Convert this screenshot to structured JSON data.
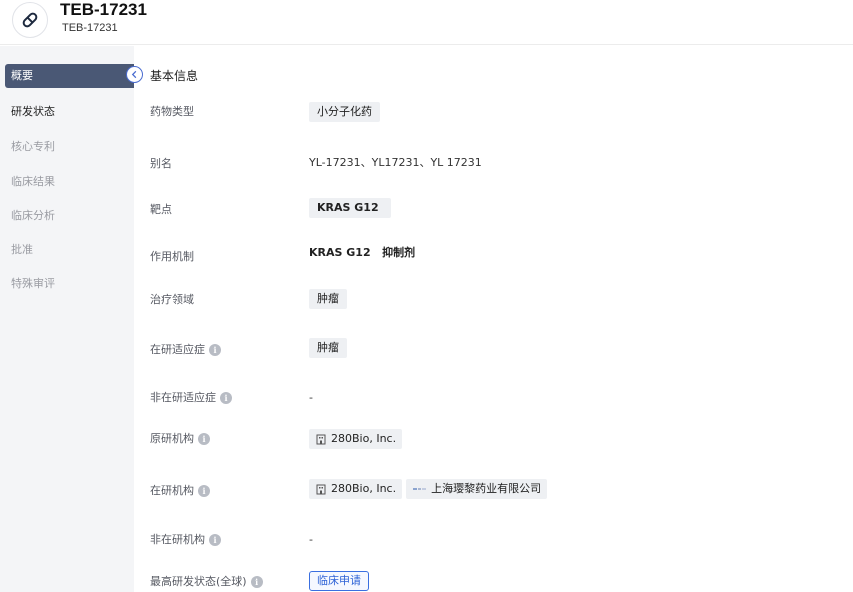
{
  "header": {
    "title": "TEB-17231",
    "subtitle": "TEB-17231",
    "logo_icon": "pill-icon"
  },
  "sidebar": {
    "items": [
      {
        "label": "概要",
        "state": "active"
      },
      {
        "label": "研发状态",
        "state": "enabled"
      },
      {
        "label": "核心专利",
        "state": "disabled"
      },
      {
        "label": "临床结果",
        "state": "disabled"
      },
      {
        "label": "临床分析",
        "state": "disabled"
      },
      {
        "label": "批准",
        "state": "disabled"
      },
      {
        "label": "特殊审评",
        "state": "disabled"
      }
    ],
    "collapse_icon": "chevron-left-icon"
  },
  "section": {
    "title": "基本信息",
    "rows": [
      {
        "label": "药物类型",
        "tags": [
          "小分子化药"
        ]
      },
      {
        "label": "别名",
        "text": "YL-17231、YL17231、YL 17231"
      },
      {
        "label": "靶点",
        "tags": [
          "KRAS G12"
        ]
      },
      {
        "label": "作用机制",
        "text": "KRAS G12   抑制剂"
      },
      {
        "label": "治疗领域",
        "tags": [
          "肿瘤"
        ]
      },
      {
        "label": "在研适应症",
        "info": true,
        "tags": [
          "肿瘤"
        ]
      },
      {
        "label": "非在研适应症",
        "info": true,
        "text": "-"
      },
      {
        "label": "原研机构",
        "info": true,
        "orgs": [
          "280Bio, Inc."
        ]
      },
      {
        "label": "在研机构",
        "info": true,
        "orgs": [
          "280Bio, Inc.",
          "上海璎黎药业有限公司"
        ]
      },
      {
        "label": "非在研机构",
        "info": true,
        "text": "-"
      },
      {
        "label": "最高研发状态(全球)",
        "info": true,
        "status": "临床申请"
      }
    ]
  },
  "colors": {
    "sidebar_active_bg": "#4a5875",
    "tag_bg": "#eef0f3",
    "status_blue": "#2e63d6",
    "info_icon": "#b8bcc4"
  }
}
